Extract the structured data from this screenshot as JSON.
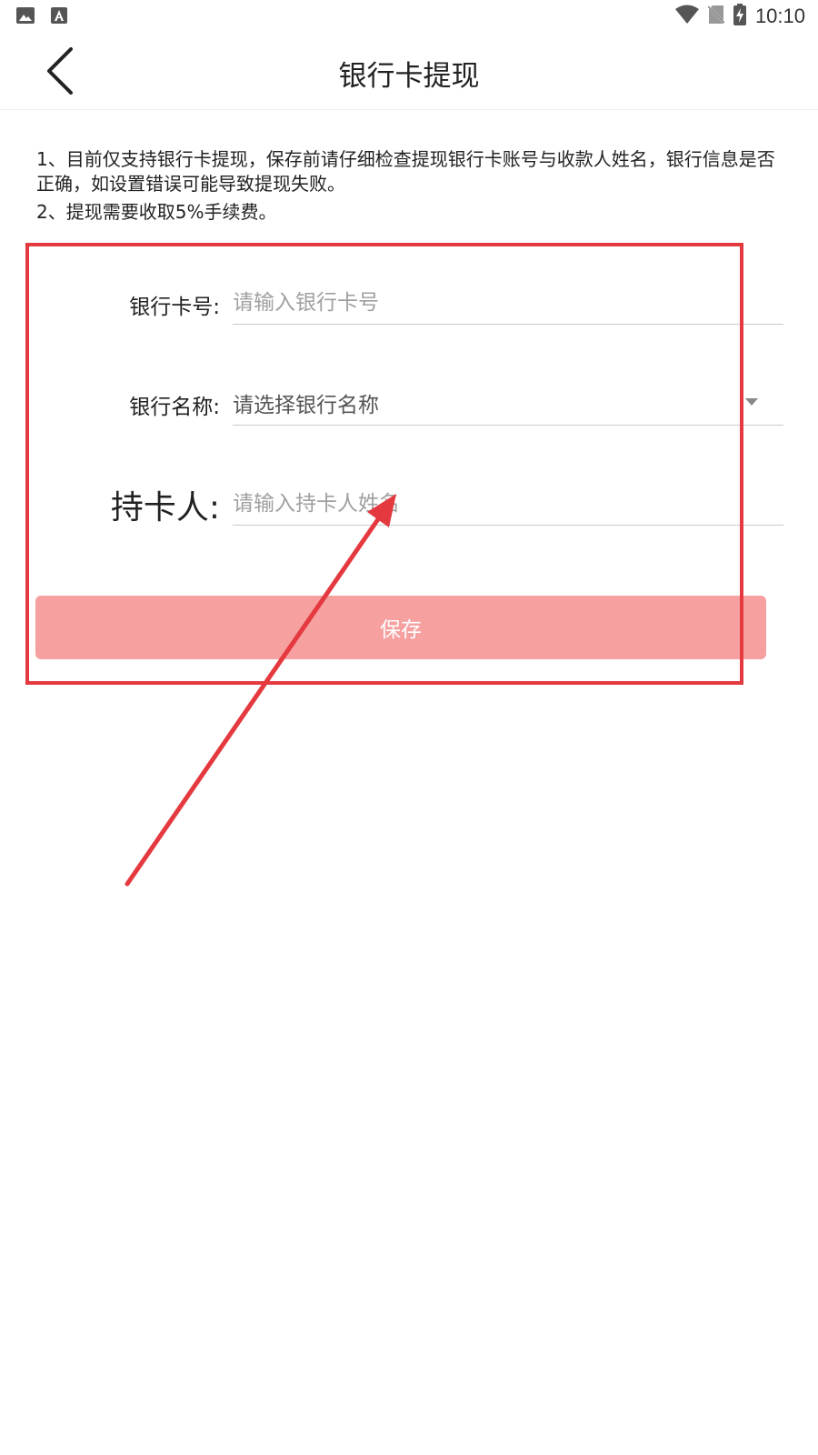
{
  "status_bar": {
    "time": "10:10",
    "icons": [
      "image-icon",
      "font-download-icon",
      "wifi-icon",
      "no-sim-icon",
      "battery-charging-icon"
    ]
  },
  "app_bar": {
    "title": "银行卡提现",
    "back_icon": "chevron-left-icon"
  },
  "notice": {
    "lines": [
      "1、目前仅支持银行卡提现，保存前请仔细检查提现银行卡账号与收款人姓名，银行信息是否正确，如设置错误可能导致提现失败。",
      "2、提现需要收取5%手续费。"
    ]
  },
  "form": {
    "card_number": {
      "label": "银行卡号:",
      "placeholder": "请输入银行卡号",
      "value": ""
    },
    "bank_name": {
      "label": "银行名称:",
      "selected": "请选择银行名称"
    },
    "holder": {
      "label": "持卡人:",
      "placeholder": "请输入持卡人姓名",
      "value": ""
    },
    "save_label": "保存"
  },
  "colors": {
    "accent": "#f6a0a0",
    "annotation": "#e53940",
    "text": "#222222",
    "placeholder": "#a0a0a0",
    "divider": "#cccccc"
  }
}
